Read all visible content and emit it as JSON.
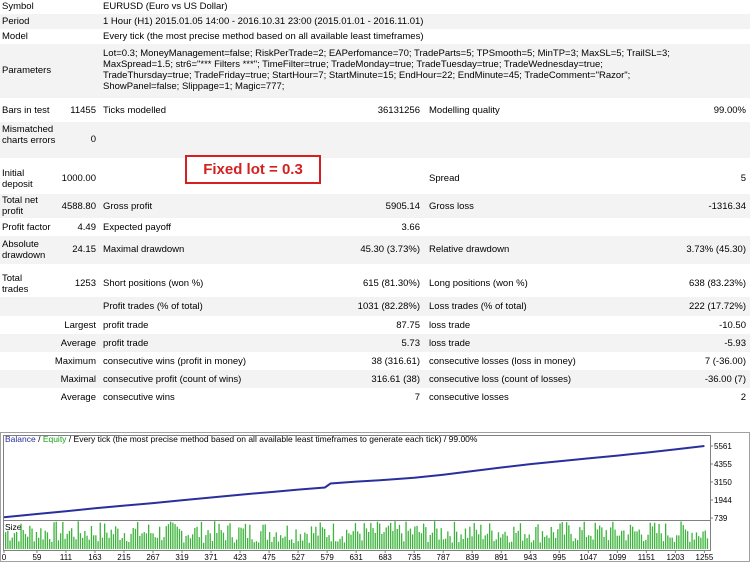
{
  "report": {
    "symbol": {
      "label": "Symbol",
      "value": "EURUSD (Euro vs US Dollar)"
    },
    "period": {
      "label": "Period",
      "value": "1 Hour (H1) 2015.01.05 14:00 - 2016.10.31 23:00 (2015.01.01 - 2016.11.01)"
    },
    "model": {
      "label": "Model",
      "value": "Every tick (the most precise method based on all available least timeframes)"
    },
    "parameters": {
      "label": "Parameters",
      "lines": [
        "Lot=0.3; MoneyManagement=false; RiskPerTrade=2; EAPerfomance=70; TradeParts=5; TPSmooth=5; MinTP=3; MaxSL=5; TrailSL=3;",
        "MaxSpread=1.5; str6=\"*** Filters ***\"; TimeFilter=true; TradeMonday=true; TradeTuesday=true; TradeWednesday=true;",
        "TradeThursday=true; TradeFriday=true; StartHour=7; StartMinute=15; EndHour=22; EndMinute=45; TradeComment=\"Razor\";",
        "ShowPanel=false; Slippage=1; Magic=777;"
      ]
    },
    "bars_in_test": {
      "label": "Bars in test",
      "value": "11455"
    },
    "ticks_modelled": {
      "label": "Ticks modelled",
      "value": "36131256"
    },
    "modelling_quality": {
      "label": "Modelling quality",
      "value": "99.00%"
    },
    "mismatched": {
      "label": "Mismatched charts errors",
      "value": "0"
    },
    "annotation": "Fixed lot = 0.3",
    "initial_deposit": {
      "label": "Initial deposit",
      "value": "1000.00"
    },
    "spread": {
      "label": "Spread",
      "value": "5"
    },
    "total_net_profit": {
      "label": "Total net profit",
      "value": "4588.80"
    },
    "gross_profit": {
      "label": "Gross profit",
      "value": "5905.14"
    },
    "gross_loss": {
      "label": "Gross loss",
      "value": "-1316.34"
    },
    "profit_factor": {
      "label": "Profit factor",
      "value": "4.49"
    },
    "expected_payoff": {
      "label": "Expected payoff",
      "value": "3.66"
    },
    "absolute_drawdown": {
      "label": "Absolute drawdown",
      "value": "24.15"
    },
    "maximal_drawdown": {
      "label": "Maximal drawdown",
      "value": "45.30 (3.73%)"
    },
    "relative_drawdown": {
      "label": "Relative drawdown",
      "value": "3.73% (45.30)"
    },
    "total_trades": {
      "label": "Total trades",
      "value": "1253"
    },
    "short_positions": {
      "label": "Short positions (won %)",
      "value": "615 (81.30%)"
    },
    "long_positions": {
      "label": "Long positions (won %)",
      "value": "638 (83.23%)"
    },
    "profit_trades": {
      "label": "Profit trades (% of total)",
      "value": "1031 (82.28%)"
    },
    "loss_trades": {
      "label": "Loss trades (% of total)",
      "value": "222 (17.72%)"
    },
    "largest": {
      "label": "Largest",
      "profit_label": "profit trade",
      "profit_value": "87.75",
      "loss_label": "loss trade",
      "loss_value": "-10.50"
    },
    "average": {
      "label": "Average",
      "profit_label": "profit trade",
      "profit_value": "5.73",
      "loss_label": "loss trade",
      "loss_value": "-5.93"
    },
    "maximum": {
      "label": "Maximum",
      "wins_label": "consecutive wins (profit in money)",
      "wins_value": "38 (316.61)",
      "losses_label": "consecutive losses (loss in money)",
      "losses_value": "7 (-36.00)"
    },
    "maximal": {
      "label": "Maximal",
      "profit_label": "consecutive profit (count of wins)",
      "profit_value": "316.61 (38)",
      "loss_label": "consecutive loss (count of losses)",
      "loss_value": "-36.00 (7)"
    },
    "average_consec": {
      "label": "Average",
      "wins_label": "consecutive wins",
      "wins_value": "7",
      "losses_label": "consecutive losses",
      "losses_value": "2"
    }
  },
  "chart_data": {
    "type": "line",
    "header": {
      "balance": "Balance",
      "sep": " / ",
      "equity": "Equity",
      "rest": " / Every tick (the most precise method based on all available least timeframes to generate each tick) / 99.00%"
    },
    "size_label": "Size",
    "y_ticks": [
      "5561",
      "4355",
      "3150",
      "1944",
      "739"
    ],
    "x_ticks": [
      "0",
      "59",
      "111",
      "163",
      "215",
      "267",
      "319",
      "371",
      "423",
      "475",
      "527",
      "579",
      "631",
      "683",
      "735",
      "787",
      "839",
      "891",
      "943",
      "995",
      "1047",
      "1099",
      "1151",
      "1203",
      "1255"
    ],
    "x_range": [
      0,
      1265
    ],
    "y_range": [
      739,
      5561
    ],
    "series": [
      {
        "name": "Balance",
        "color": "#2a2f9e",
        "x": [
          0,
          59,
          111,
          163,
          215,
          267,
          319,
          371,
          423,
          475,
          527,
          575,
          585,
          631,
          683,
          735,
          787,
          839,
          891,
          943,
          995,
          1047,
          1099,
          1151,
          1203,
          1255
        ],
        "y": [
          790,
          1010,
          1190,
          1390,
          1570,
          1740,
          1930,
          2110,
          2300,
          2470,
          2640,
          2780,
          3050,
          3180,
          3290,
          3430,
          3640,
          3880,
          4120,
          4350,
          4540,
          4730,
          4920,
          5120,
          5330,
          5561
        ]
      }
    ],
    "colors": {
      "balance": "#2a2f9e",
      "equity": "#1aa11a",
      "size": "#3cb43c",
      "frame": "#808080"
    }
  }
}
